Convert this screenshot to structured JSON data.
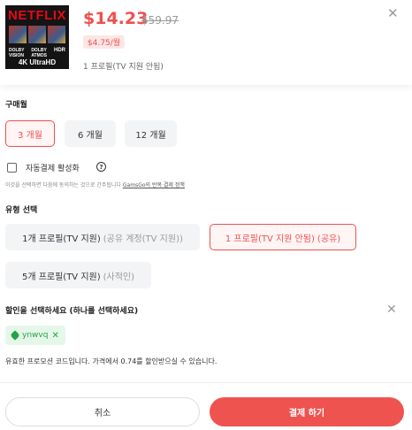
{
  "product": {
    "logo_text": "NETFLIX",
    "badge_left": "DOLBY VISION",
    "badge_mid": "DOLBY ATMOS",
    "badge_hdr": "HDR",
    "uhd_text": "4K UltraHD",
    "price": "$14.23",
    "old_price": "$59.97",
    "monthly": "$4.75/월",
    "profile_note": "1 프로필(TV 지원 안됨)"
  },
  "period": {
    "label": "구매월",
    "options": [
      "3 개월",
      "6 개월",
      "12 개월"
    ],
    "selected": "3 개월"
  },
  "auto_pay": {
    "label": "자동결제 활성화",
    "help": "?",
    "note_prefix": "이것을 선택하면 다음에 동의하는 것으로 간주됩니다",
    "note_link": "GamsGo의 반복 결제 정책"
  },
  "type": {
    "label": "유형 선택",
    "options": [
      {
        "main": "1개 프로필(TV 지원)",
        "sub": "(공유 계정(TV 지원))"
      },
      {
        "main": "1 프로필(TV 지원 안됨)",
        "sub": "(공유)"
      },
      {
        "main": "5개 프로필(TV 지원)",
        "sub": "(사적인)"
      }
    ],
    "selected_index": 1
  },
  "discount": {
    "label": "할인을 선택하세요 (하나를 선택하세요)",
    "coupon_code": "ynwvq",
    "note": "유효한 프로모션 코드입니다. 가격에서 0.74를 할인받으실 수 있습니다."
  },
  "actions": {
    "cancel": "취소",
    "pay": "결제 하기"
  },
  "colors": {
    "accent": "#ef4f4f",
    "coupon_green": "#22a447"
  },
  "icons": {
    "close": "✕",
    "coupon_remove": "✕"
  }
}
